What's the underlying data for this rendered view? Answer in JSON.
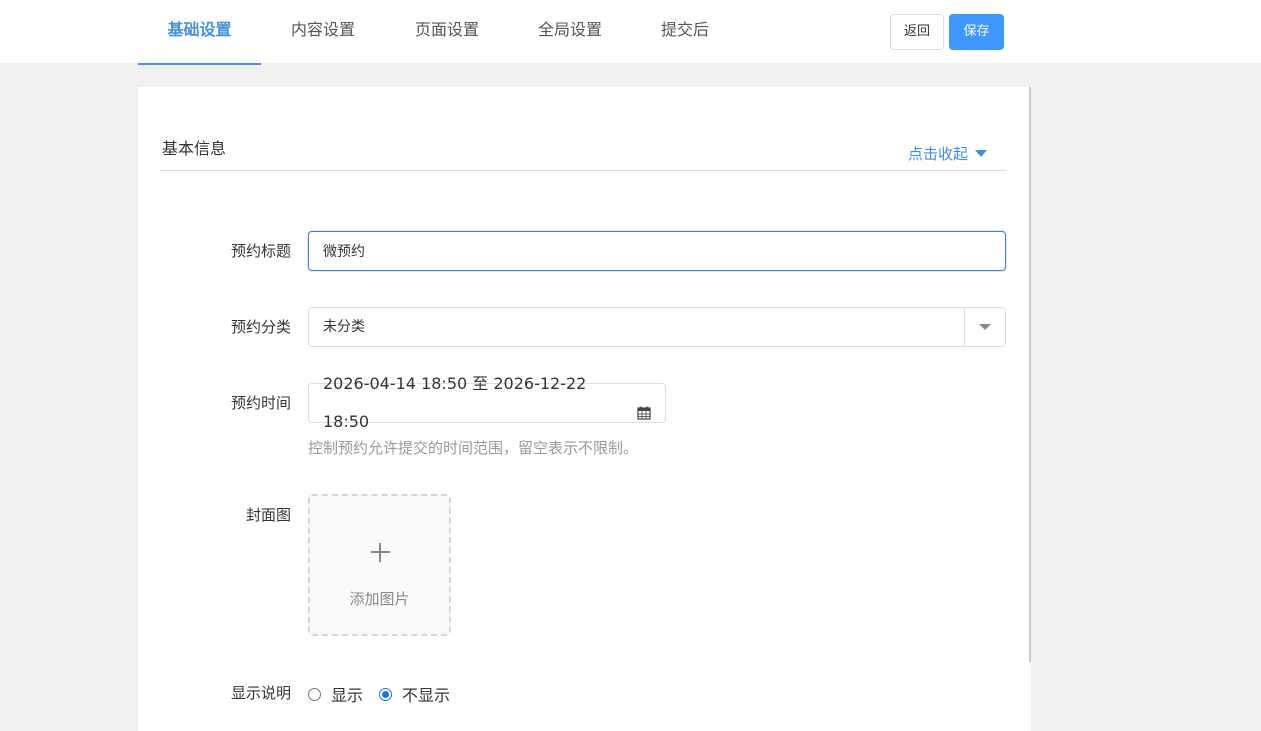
{
  "tabs": [
    {
      "label": "基础设置",
      "active": true
    },
    {
      "label": "内容设置",
      "active": false
    },
    {
      "label": "页面设置",
      "active": false
    },
    {
      "label": "全局设置",
      "active": false
    },
    {
      "label": "提交后",
      "active": false
    }
  ],
  "actions": {
    "back_label": "返回",
    "save_label": "保存"
  },
  "section": {
    "title": "基本信息",
    "collapse_label": "点击收起"
  },
  "form": {
    "title": {
      "label": "预约标题",
      "value": "微预约"
    },
    "category": {
      "label": "预约分类",
      "selected": "未分类"
    },
    "time": {
      "label": "预约时间",
      "value": "2026-04-14 18:50 至 2026-12-22 18:50",
      "hint": "控制预约允许提交的时间范围，留空表示不限制。"
    },
    "cover": {
      "label": "封面图",
      "upload_label": "添加图片"
    },
    "show_desc": {
      "label": "显示说明",
      "options": [
        {
          "label": "显示",
          "checked": false
        },
        {
          "label": "不显示",
          "checked": true
        }
      ]
    }
  },
  "colors": {
    "accent": "#3e97ff",
    "link": "#3e8ee5",
    "active_tab": "#4a8fdb"
  }
}
